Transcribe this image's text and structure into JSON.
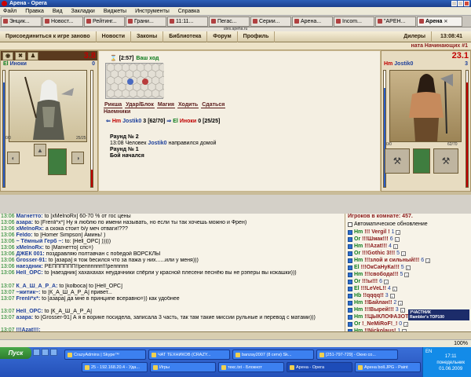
{
  "window": {
    "title": "Арена - Opera"
  },
  "menu": [
    "Файл",
    "Правка",
    "Вид",
    "Закладки",
    "Виджеты",
    "Инструменты",
    "Справка"
  ],
  "tabs": [
    {
      "label": "Энцик..."
    },
    {
      "label": "Новост..."
    },
    {
      "label": "Рейтинг..."
    },
    {
      "label": "Грани..."
    },
    {
      "label": "11:11..."
    },
    {
      "label": "Пегас..."
    },
    {
      "label": "Серии..."
    },
    {
      "label": "Арена..."
    },
    {
      "label": "Incom..."
    },
    {
      "label": "\"АРЕН..."
    },
    {
      "label": "Арена",
      "active": true
    }
  ],
  "address": "utes.apeha.ru",
  "game_nav": {
    "join": "Присоединиться к игре заново",
    "news": "Новости",
    "laws": "Законы",
    "library": "Библиотека",
    "forum": "Форум",
    "profile": "Профиль",
    "dealers": "Дилеры",
    "time": "13:08:41"
  },
  "room": "ната Начинающих #1",
  "left_fighter": {
    "tag": "El",
    "name": "Иноки",
    "level": "0",
    "hp": "3.8",
    "hp_fraction": 0.15,
    "mana_fraction": 0.9,
    "stat1": "0/0",
    "stat2": "25/25"
  },
  "right_fighter": {
    "tag": "Hm",
    "name": "Jostik0",
    "level": "3",
    "hp": "23.1",
    "hp_fraction": 0.9,
    "mana_fraction": 0.85,
    "stat1": "0/0",
    "stat2": "62/70"
  },
  "battle": {
    "timer": "[2:57]",
    "your_turn": "Ваш ход",
    "actions": [
      "Рикша",
      "Удар/Блок",
      "Магия",
      "Ходить",
      "Сдаться"
    ],
    "action2": "Наемники",
    "versus": {
      "left_tag": "Hm",
      "left_name": "Jostik0",
      "left_lvl": "3",
      "left_hp": "[62/70]",
      "mid": "⇒",
      "right_tag": "El",
      "right_name": "Иноки",
      "right_lvl": "0",
      "right_hp": "[25/25]"
    },
    "log": [
      {
        "text": "Раунд № 2",
        "bold": true
      },
      {
        "time": "13:08",
        "pre": "Человек",
        "user": "Jostik0",
        "post": "направился домой"
      },
      {
        "text": "Раунд № 1",
        "bold": true
      },
      {
        "text": "Бой начался",
        "bold": true
      }
    ]
  },
  "chat": [
    {
      "time": "13:06",
      "nick": "Магнетто:",
      "text": "to [xMelnoRx] 60-70 % от гос цены"
    },
    {
      "time": "13:06",
      "nick": "азара:",
      "text": "to [Frenli*x*] Ну я люблю по имени называть, но если ты так хочешь можно и Френ)"
    },
    {
      "time": "13:06",
      "nick": "xMelnoRx:",
      "text": "а скока стоит б/у меч отваги!???"
    },
    {
      "time": "13:06",
      "nick": "Feldo:",
      "text": "to [Homer Simpson] Аминь! )"
    },
    {
      "time": "13:06",
      "nick": "~ Тёмный Герб ~:",
      "text": "to: [Hell_OPC] )))))"
    },
    {
      "time": "13:06",
      "nick": "xMelnoRx:",
      "text": "to [Магнетто] спс=)"
    },
    {
      "time": "13:06",
      "nick": "ДЖЕК 001:",
      "text": "поздравляю полтавчан с победой ВОРСКЛЫ"
    },
    {
      "time": "13:06",
      "nick": "Grosser-91:",
      "text": "to [азара] я тож бесился что за пажа у них......или у меня)))"
    },
    {
      "time": "13:06",
      "nick": "наездник:",
      "text": "РЕПППППП!!репппппп!!!реппппп"
    },
    {
      "time": "13:06",
      "nick": "Hell_OPC:",
      "text": "to [наездник] хахахахах неудачники спёрли у красной плесени песнёю вы не рэперы вы кокашки)))"
    },
    {
      "gap": true
    },
    {
      "time": "13:07",
      "nick": "К_А_Ш_А_Р_А:",
      "text": "to [kolboca] to [Hell_OPC]"
    },
    {
      "time": "13:07",
      "nick": "~житик~:",
      "text": "to [К_А_Ш_А_Р_А] привет..."
    },
    {
      "time": "13:07",
      "nick": "Frenli*x*:",
      "text": "to [азара] да мне в принципе всеравно=)) как удобнее"
    },
    {
      "gap": true
    },
    {
      "time": "13:07",
      "nick": "Hell_OPC:",
      "text": "to [К_А_Ш_А_Р_А]"
    },
    {
      "time": "13:07",
      "nick": "азара:",
      "text": "to [Grosser-91] А я в ворике посидела, записала 3 часть, так там такие миссии рульные и перевод с матами)))"
    },
    {
      "gap": true
    },
    {
      "time": "13:07",
      "nick": "!!!Azat!!!:",
      "text": ""
    },
    {
      "time": "13:07",
      "nick": "наездник:",
      "text": "давай в стобой плен на плен (Щаз реп)"
    }
  ],
  "players": {
    "title": "Игроков в комнате: 457.",
    "auto": "Автоматическое обновление",
    "list": [
      {
        "tag": "Hm",
        "name": "!!! Vergil !",
        "lvl": "1"
      },
      {
        "tag": "Or",
        "name": "!!!Шмак!!!",
        "lvl": "6"
      },
      {
        "tag": "Hm",
        "name": "!!!Azat!!!",
        "lvl": "4"
      },
      {
        "tag": "Or",
        "name": "!!!Gothic 3!!!",
        "lvl": "5"
      },
      {
        "tag": "Hm",
        "name": "!!!злой и сильный!!!",
        "lvl": "6"
      },
      {
        "tag": "El",
        "name": "!!!ОкСаНуКа!!!",
        "lvl": "5"
      },
      {
        "tag": "Hm",
        "name": "!!!свобода!!!",
        "lvl": "5"
      },
      {
        "tag": "Or",
        "name": "!!!ы!!!",
        "lvl": "6"
      },
      {
        "tag": "El",
        "name": "!!!LeVeL!!",
        "lvl": "4"
      },
      {
        "tag": "Hb",
        "name": "!!qqqq!!",
        "lvl": "3"
      },
      {
        "tag": "Hm",
        "name": "!!Байлан!!",
        "lvl": "2"
      },
      {
        "tag": "Hm",
        "name": "!!!Вырей!!!",
        "lvl": "3"
      },
      {
        "tag": "Hm",
        "name": "!!ЦЫКЛОФАЗОТРОН!!",
        "lvl": "4"
      },
      {
        "tag": "Or",
        "name": "!_NeMiRoF!_!",
        "lvl": "0"
      },
      {
        "tag": "Hm",
        "name": "!!Nickolaus!",
        "lvl": "1"
      }
    ]
  },
  "badge": {
    "line1": "УЧАСТНИК",
    "line2": "Rambler's TOP100"
  },
  "statusbar": {
    "zoom": "100%"
  },
  "taskbar": {
    "start": "Пуск",
    "row1": [
      {
        "label": "CrazyAdmins | Skype™",
        "active": false
      },
      {
        "label": "ЧАТ ТЕХНИКОВ (CRAZY...",
        "active": false
      },
      {
        "label": "banzay2007 (8 сети) Sk...",
        "active": false
      },
      {
        "label": "[251-797-729] - Окно со...",
        "active": false
      }
    ],
    "row2": [
      {
        "label": "25 - 192.168.20.4 - Уда...",
        "active": false
      },
      {
        "label": "Игры",
        "active": false
      },
      {
        "label": "текс.txt - Блокнот",
        "active": false
      },
      {
        "label": "Арена - Opera",
        "active": true
      },
      {
        "label": "Арена boll.JPG - Paint",
        "active": false
      }
    ],
    "lang": "EN",
    "clock": "17:11",
    "day": "понедельник",
    "date": "01.06.2009"
  }
}
